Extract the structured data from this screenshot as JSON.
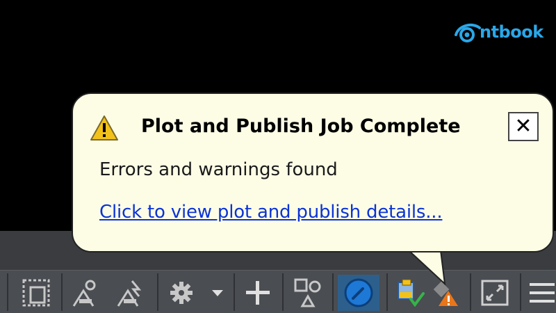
{
  "watermark": {
    "brand_text": "ntbook",
    "logo_icon": "eye-swoosh-logo-icon"
  },
  "notification": {
    "title": "Plot and Publish Job Complete",
    "message": "Errors and warnings found",
    "link_text": "Click to view plot and publish details...",
    "close_label": "✕",
    "icon": "warning-triangle-icon",
    "colors": {
      "background": "#fdfde6",
      "link": "#0a33d6",
      "warning": "#f2c21b"
    }
  },
  "status_bar": {
    "buttons": [
      {
        "icon": "viewport-frame-icon"
      },
      {
        "icon": "annotation-scale-icon"
      },
      {
        "icon": "annotation-visibility-icon"
      },
      {
        "icon": "workspace-gear-icon"
      },
      {
        "icon": "dropdown-arrow-icon"
      },
      {
        "icon": "annotation-monitor-plus-icon"
      },
      {
        "icon": "isolate-objects-icon"
      },
      {
        "icon": "hardware-acceleration-icon"
      },
      {
        "icon": "plot-publish-complete-icon"
      },
      {
        "icon": "plot-publish-warning-icon"
      },
      {
        "icon": "fullscreen-icon"
      },
      {
        "icon": "customization-menu-icon"
      }
    ],
    "colors": {
      "bar": "#4a4d52",
      "active": "#1e78d6"
    }
  }
}
